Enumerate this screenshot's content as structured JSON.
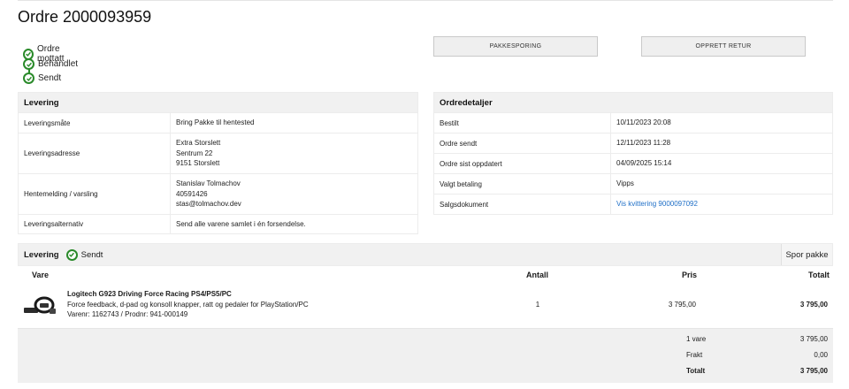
{
  "order": {
    "title": "Ordre 2000093959"
  },
  "status_steps": [
    "Ordre mottatt",
    "Behandlet",
    "Sendt"
  ],
  "buttons": {
    "tracking": "PAKKESPORING",
    "return": "OPPRETT RETUR"
  },
  "delivery_info": {
    "heading": "Levering",
    "rows": [
      {
        "label": "Leveringsmåte",
        "value": [
          "Bring Pakke til hentested"
        ]
      },
      {
        "label": "Leveringsadresse",
        "value": [
          "Extra Storslett",
          "Sentrum 22",
          "9151 Storslett"
        ]
      },
      {
        "label": "Hentemelding / varsling",
        "value": [
          "Stanislav Tolmachov",
          "40591426",
          "stas@tolmachov.dev"
        ]
      },
      {
        "label": "Leveringsalternativ",
        "value": [
          "Send alle varene samlet i én forsendelse."
        ]
      }
    ]
  },
  "order_details": {
    "heading": "Ordredetaljer",
    "rows": [
      {
        "label": "Bestilt",
        "value": "10/11/2023 20:08"
      },
      {
        "label": "Ordre sendt",
        "value": "12/11/2023 11:28"
      },
      {
        "label": "Ordre sist oppdatert",
        "value": "04/09/2025 15:14"
      },
      {
        "label": "Valgt betaling",
        "value": "Vipps"
      },
      {
        "label": "Salgsdokument",
        "value": "Vis kvittering 9000097092",
        "is_link": true
      }
    ]
  },
  "shipment": {
    "title": "Levering",
    "status": "Sendt",
    "track_label": "Spor pakke",
    "columns": {
      "item": "Vare",
      "qty": "Antall",
      "price": "Pris",
      "total": "Totalt"
    },
    "items": [
      {
        "name": "Logitech G923 Driving Force Racing PS4/PS5/PC",
        "description": "Force feedback, d-pad og konsoll knapper, ratt og pedaler for PlayStation/PC",
        "sku": "Varenr: 1162743 / Prodnr: 941-000149",
        "qty": "1",
        "price": "3 795,00",
        "total": "3 795,00"
      }
    ],
    "summary": [
      {
        "label": "1 vare",
        "value": "3 795,00",
        "bold": false
      },
      {
        "label": "Frakt",
        "value": "0,00",
        "bold": false
      },
      {
        "label": "Totalt",
        "value": "3 795,00",
        "bold": true
      }
    ]
  },
  "colors": {
    "success": "#2a8a2a",
    "link": "#1f6fc7",
    "panel_header": "#f1f1f1"
  }
}
